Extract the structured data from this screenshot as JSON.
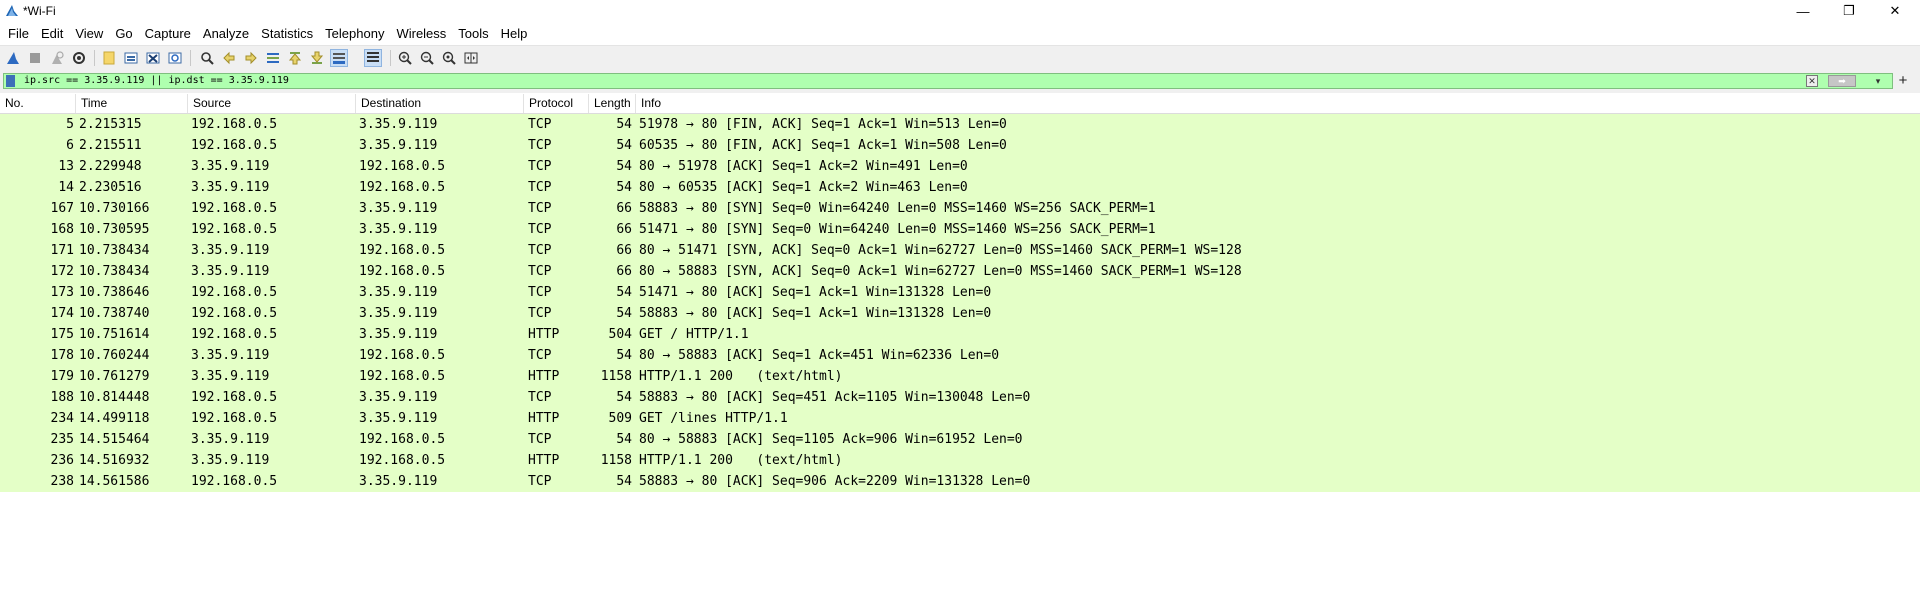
{
  "window": {
    "title": "*Wi-Fi",
    "controls": {
      "minimize": "—",
      "maximize": "❐",
      "close": "✕"
    }
  },
  "menu": [
    "File",
    "Edit",
    "View",
    "Go",
    "Capture",
    "Analyze",
    "Statistics",
    "Telephony",
    "Wireless",
    "Tools",
    "Help"
  ],
  "toolbar": {
    "icons": [
      "shark-fin-start-icon",
      "stop-capture-icon",
      "restart-capture-icon",
      "capture-options-icon",
      "open-file-icon",
      "save-file-icon",
      "close-file-icon",
      "reload-icon",
      "find-packet-icon",
      "go-back-icon",
      "go-forward-icon",
      "go-to-packet-icon",
      "go-first-icon",
      "go-last-icon",
      "autoscroll-icon",
      "colorize-icon",
      "zoom-in-icon",
      "zoom-out-icon",
      "zoom-normal-icon",
      "resize-columns-icon"
    ]
  },
  "filter": {
    "value": "ip.src == 3.35.9.119 || ip.dst == 3.35.9.119",
    "bar_color": "#afffaf",
    "clear_symbol": "✕",
    "apply_symbol": "➡",
    "dropdown_symbol": "▾",
    "add_symbol": "+"
  },
  "packet_list": {
    "columns": [
      "No.",
      "Time",
      "Source",
      "Destination",
      "Protocol",
      "Length",
      "Info"
    ],
    "row_color": "#e4ffc7",
    "rows": [
      [
        "5",
        "2.215315",
        "192.168.0.5",
        "3.35.9.119",
        "TCP",
        "54",
        "51978 → 80 [FIN, ACK] Seq=1 Ack=1 Win=513 Len=0"
      ],
      [
        "6",
        "2.215511",
        "192.168.0.5",
        "3.35.9.119",
        "TCP",
        "54",
        "60535 → 80 [FIN, ACK] Seq=1 Ack=1 Win=508 Len=0"
      ],
      [
        "13",
        "2.229948",
        "3.35.9.119",
        "192.168.0.5",
        "TCP",
        "54",
        "80 → 51978 [ACK] Seq=1 Ack=2 Win=491 Len=0"
      ],
      [
        "14",
        "2.230516",
        "3.35.9.119",
        "192.168.0.5",
        "TCP",
        "54",
        "80 → 60535 [ACK] Seq=1 Ack=2 Win=463 Len=0"
      ],
      [
        "167",
        "10.730166",
        "192.168.0.5",
        "3.35.9.119",
        "TCP",
        "66",
        "58883 → 80 [SYN] Seq=0 Win=64240 Len=0 MSS=1460 WS=256 SACK_PERM=1"
      ],
      [
        "168",
        "10.730595",
        "192.168.0.5",
        "3.35.9.119",
        "TCP",
        "66",
        "51471 → 80 [SYN] Seq=0 Win=64240 Len=0 MSS=1460 WS=256 SACK_PERM=1"
      ],
      [
        "171",
        "10.738434",
        "3.35.9.119",
        "192.168.0.5",
        "TCP",
        "66",
        "80 → 51471 [SYN, ACK] Seq=0 Ack=1 Win=62727 Len=0 MSS=1460 SACK_PERM=1 WS=128"
      ],
      [
        "172",
        "10.738434",
        "3.35.9.119",
        "192.168.0.5",
        "TCP",
        "66",
        "80 → 58883 [SYN, ACK] Seq=0 Ack=1 Win=62727 Len=0 MSS=1460 SACK_PERM=1 WS=128"
      ],
      [
        "173",
        "10.738646",
        "192.168.0.5",
        "3.35.9.119",
        "TCP",
        "54",
        "51471 → 80 [ACK] Seq=1 Ack=1 Win=131328 Len=0"
      ],
      [
        "174",
        "10.738740",
        "192.168.0.5",
        "3.35.9.119",
        "TCP",
        "54",
        "58883 → 80 [ACK] Seq=1 Ack=1 Win=131328 Len=0"
      ],
      [
        "175",
        "10.751614",
        "192.168.0.5",
        "3.35.9.119",
        "HTTP",
        "504",
        "GET / HTTP/1.1"
      ],
      [
        "178",
        "10.760244",
        "3.35.9.119",
        "192.168.0.5",
        "TCP",
        "54",
        "80 → 58883 [ACK] Seq=1 Ack=451 Win=62336 Len=0"
      ],
      [
        "179",
        "10.761279",
        "3.35.9.119",
        "192.168.0.5",
        "HTTP",
        "1158",
        "HTTP/1.1 200   (text/html)"
      ],
      [
        "188",
        "10.814448",
        "192.168.0.5",
        "3.35.9.119",
        "TCP",
        "54",
        "58883 → 80 [ACK] Seq=451 Ack=1105 Win=130048 Len=0"
      ],
      [
        "234",
        "14.499118",
        "192.168.0.5",
        "3.35.9.119",
        "HTTP",
        "509",
        "GET /lines HTTP/1.1"
      ],
      [
        "235",
        "14.515464",
        "3.35.9.119",
        "192.168.0.5",
        "TCP",
        "54",
        "80 → 58883 [ACK] Seq=1105 Ack=906 Win=61952 Len=0"
      ],
      [
        "236",
        "14.516932",
        "3.35.9.119",
        "192.168.0.5",
        "HTTP",
        "1158",
        "HTTP/1.1 200   (text/html)"
      ],
      [
        "238",
        "14.561586",
        "192.168.0.5",
        "3.35.9.119",
        "TCP",
        "54",
        "58883 → 80 [ACK] Seq=906 Ack=2209 Win=131328 Len=0"
      ]
    ]
  }
}
